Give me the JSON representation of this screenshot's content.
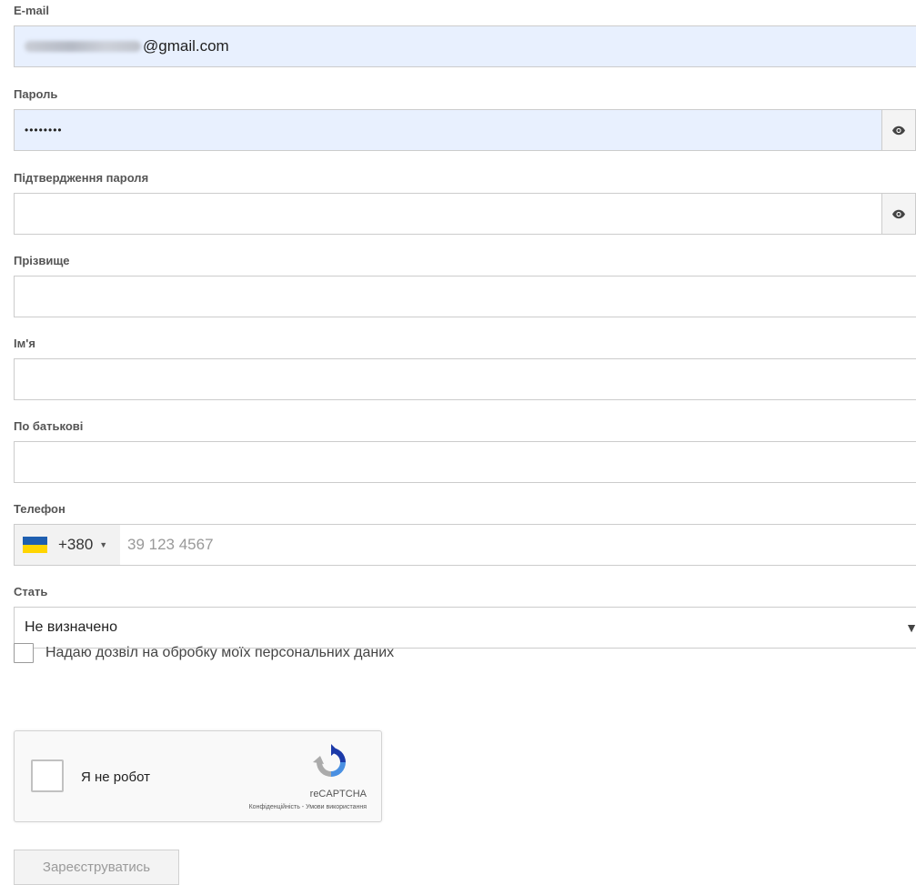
{
  "form": {
    "email": {
      "label": "E-mail",
      "value_suffix": "@gmail.com"
    },
    "password": {
      "label": "Пароль",
      "value": "••••••••"
    },
    "password_confirm": {
      "label": "Підтвердження пароля",
      "value": ""
    },
    "last_name": {
      "label": "Прізвище",
      "value": ""
    },
    "first_name": {
      "label": "Ім'я",
      "value": ""
    },
    "middle_name": {
      "label": "По батькові",
      "value": ""
    },
    "phone": {
      "label": "Телефон",
      "country_code": "+380",
      "placeholder": "39 123 4567",
      "flag": "ukraine-flag-icon"
    },
    "gender": {
      "label": "Стать",
      "selected": "Не визначено"
    },
    "consent": {
      "label": "Надаю дозвіл на обробку моїх персональних даних",
      "checked": false
    },
    "submit_label": "Зареєструватись"
  },
  "recaptcha": {
    "label": "Я не робот",
    "brand": "reCAPTCHA",
    "links": "Конфіденційність - Умови використання"
  },
  "colors": {
    "autofill_bg": "#e8f0fe",
    "border": "#cccccc",
    "label": "#555555",
    "flag_blue": "#1f5fb0",
    "flag_yellow": "#ffd500"
  },
  "icons": {
    "password_toggle": "eye-icon",
    "select_caret": "caret-down-icon"
  }
}
